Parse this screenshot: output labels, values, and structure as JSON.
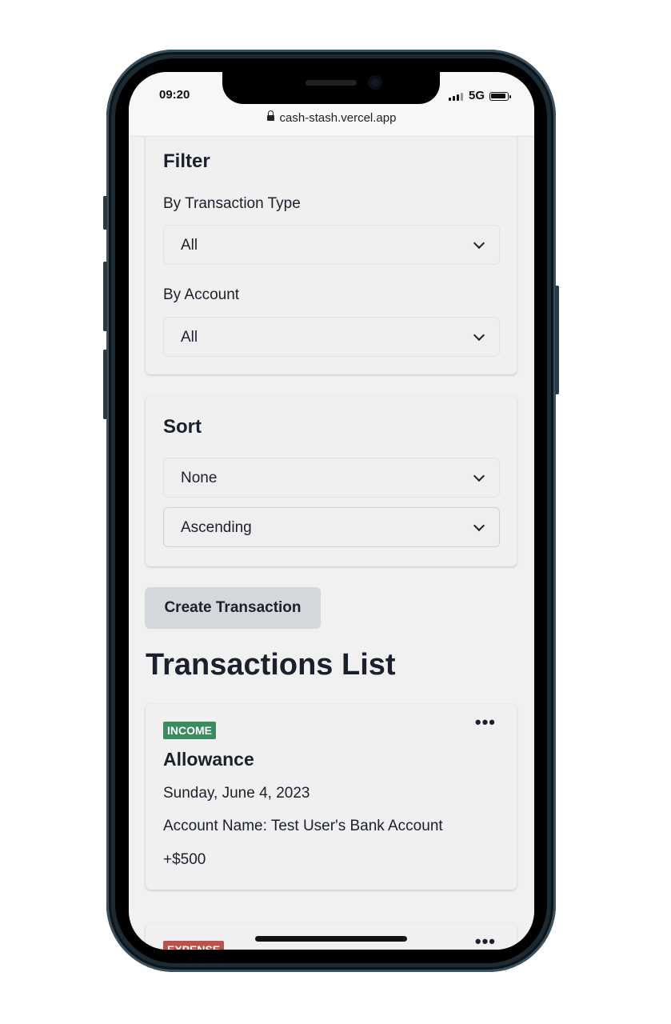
{
  "status_bar": {
    "time": "09:20",
    "network": "5G"
  },
  "browser": {
    "url": "cash-stash.vercel.app"
  },
  "filter": {
    "title": "Filter",
    "type_label": "By Transaction Type",
    "type_value": "All",
    "account_label": "By Account",
    "account_value": "All"
  },
  "sort": {
    "title": "Sort",
    "field_value": "None",
    "order_value": "Ascending"
  },
  "create_button": "Create Transaction",
  "list_title": "Transactions List",
  "transactions": [
    {
      "type": "INCOME",
      "name": "Allowance",
      "date": "Sunday, June 4, 2023",
      "account": "Account Name: Test User's Bank Account",
      "amount": "+$500"
    },
    {
      "type": "EXPENSE"
    }
  ],
  "colors": {
    "income": "#3d8a5e",
    "expense": "#b5534d",
    "background": "#f1f1f1"
  }
}
